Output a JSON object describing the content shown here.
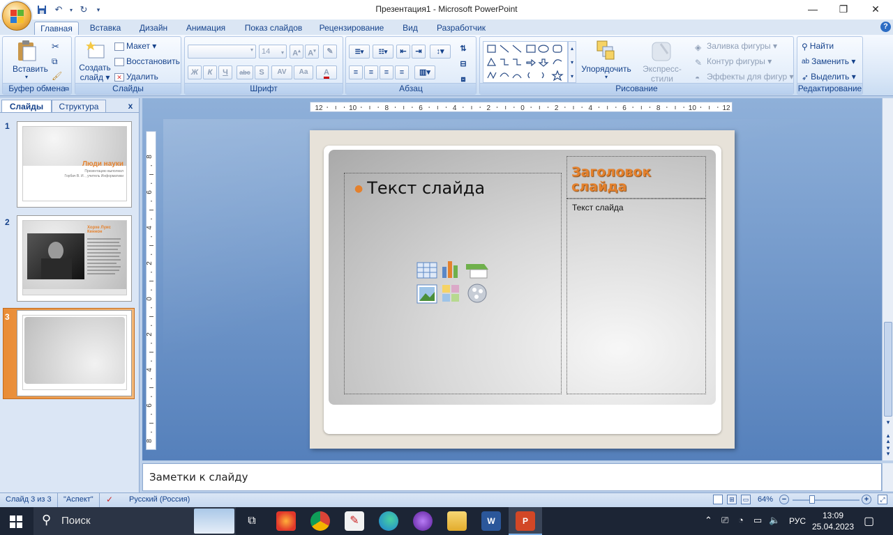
{
  "window": {
    "title": "Презентация1 - Microsoft PowerPoint",
    "minimize": "—",
    "maximize": "❐",
    "close": "✕"
  },
  "ribbon": {
    "tabs": [
      "Главная",
      "Вставка",
      "Дизайн",
      "Анимация",
      "Показ слайдов",
      "Рецензирование",
      "Вид",
      "Разработчик"
    ],
    "active_tab": "Главная",
    "groups": {
      "clipboard": {
        "label": "Буфер обмена",
        "paste": "Вставить"
      },
      "slides": {
        "label": "Слайды",
        "new_slide": "Создать",
        "new_slide_2": "слайд",
        "layout": "Макет",
        "reset": "Восстановить",
        "delete": "Удалить"
      },
      "font": {
        "label": "Шрифт",
        "size": "14",
        "bold": "Ж",
        "italic": "К",
        "underline": "Ч",
        "strike": "abc",
        "shadow": "S",
        "spacing": "AV",
        "case": "Aa"
      },
      "paragraph": {
        "label": "Абзац"
      },
      "drawing": {
        "label": "Рисование",
        "arrange": "Упорядочить",
        "quick_styles": "Экспресс-стили",
        "fill": "Заливка фигуры",
        "outline": "Контур фигуры",
        "effects": "Эффекты для фигур"
      },
      "editing": {
        "label": "Редактирование",
        "find": "Найти",
        "replace": "Заменить",
        "select": "Выделить"
      }
    }
  },
  "left_pane": {
    "tab_slides": "Слайды",
    "tab_outline": "Структура",
    "close": "x",
    "slides": [
      {
        "num": "1",
        "title": "Люди науки",
        "sub1": "Презентацию выполнил",
        "sub2": "Горбач В. И. , учитель Информатики"
      },
      {
        "num": "2",
        "title": "Хорхе Луис Кеннон"
      },
      {
        "num": "3"
      }
    ]
  },
  "slide": {
    "content_placeholder": "Текст слайда",
    "title_placeholder": "Заголовок слайда",
    "side_text": "Текст слайда"
  },
  "rulers": {
    "h_ticks": [
      "12",
      "10",
      "8",
      "6",
      "4",
      "2",
      "0",
      "2",
      "4",
      "6",
      "8",
      "10",
      "12"
    ],
    "v_ticks": [
      "8",
      "6",
      "4",
      "2",
      "0",
      "2",
      "4",
      "6",
      "8"
    ]
  },
  "notes": {
    "placeholder": "Заметки к слайду"
  },
  "status": {
    "slide": "Слайд 3 из 3",
    "theme": "\"Аспект\"",
    "language": "Русский (Россия)",
    "zoom": "64%"
  },
  "taskbar": {
    "search": "Поиск",
    "lang": "РУС",
    "time": "13:09",
    "date": "25.04.2023"
  },
  "colors": {
    "accent_orange": "#e4812d",
    "ribbon_blue": "#15428b"
  }
}
